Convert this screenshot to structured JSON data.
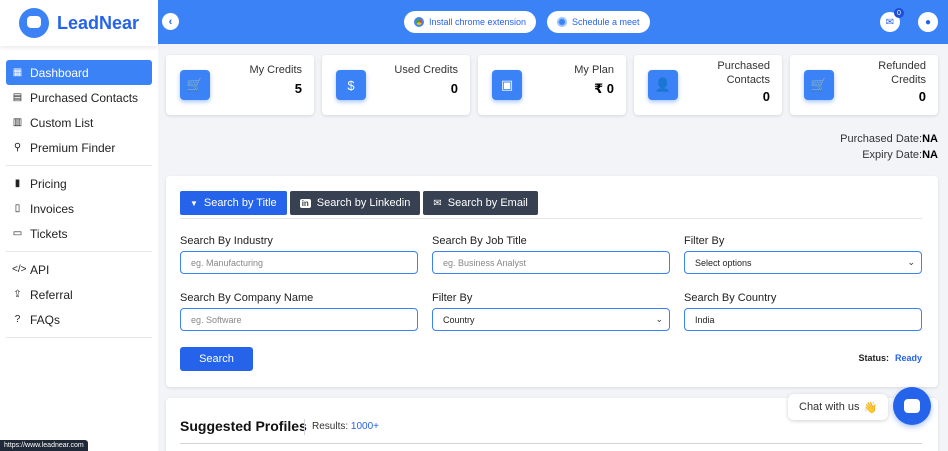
{
  "brand": {
    "name": "LeadNear"
  },
  "sidebar": {
    "items": [
      {
        "label": "Dashboard",
        "icon": "dashboard-icon",
        "glyph": "▦"
      },
      {
        "label": "Purchased Contacts",
        "icon": "contacts-icon",
        "glyph": "▤"
      },
      {
        "label": "Custom List",
        "icon": "list-icon",
        "glyph": "▥"
      },
      {
        "label": "Premium Finder",
        "icon": "search-icon",
        "glyph": "⚲"
      },
      {
        "label": "Pricing",
        "icon": "pricing-icon",
        "glyph": "▮"
      },
      {
        "label": "Invoices",
        "icon": "invoice-icon",
        "glyph": "▯"
      },
      {
        "label": "Tickets",
        "icon": "ticket-icon",
        "glyph": "▭"
      },
      {
        "label": "API",
        "icon": "code-icon",
        "glyph": "</>"
      },
      {
        "label": "Referral",
        "icon": "share-icon",
        "glyph": "⇪"
      },
      {
        "label": "FAQs",
        "icon": "question-icon",
        "glyph": "?"
      }
    ]
  },
  "status_url": "https://www.leadnear.com",
  "topbar": {
    "back_glyph": "‹",
    "chrome_label": "Install chrome extension",
    "meet_label": "Schedule a meet",
    "notifications_count": "0"
  },
  "cards": [
    {
      "label": "My Credits",
      "value": "5",
      "icon": "cart-icon",
      "glyph": "🛒"
    },
    {
      "label": "Used Credits",
      "value": "0",
      "icon": "dollar-icon",
      "glyph": "$"
    },
    {
      "label": "My Plan",
      "value": "₹ 0",
      "icon": "wallet-icon",
      "glyph": "▣"
    },
    {
      "label": "Purchased Contacts",
      "value": "0",
      "icon": "user-icon",
      "glyph": "👤"
    },
    {
      "label": "Refunded Credits",
      "value": "0",
      "icon": "cart-refund-icon",
      "glyph": "🛒"
    }
  ],
  "dates": {
    "purchased_label": "Purchased Date:",
    "purchased_value": "NA",
    "expiry_label": "Expiry Date:",
    "expiry_value": "NA"
  },
  "search": {
    "tabs": [
      {
        "label": "Search by Title",
        "glyph": "▼"
      },
      {
        "label": "Search by Linkedin",
        "glyph": "in"
      },
      {
        "label": "Search by Email",
        "glyph": "✉"
      }
    ],
    "industry_label": "Search By Industry",
    "industry_placeholder": "eg. Manufacturing",
    "job_title_label": "Search By Job Title",
    "job_title_placeholder": "eg. Business Analyst",
    "filter_label": "Filter By",
    "filter_value": "Select options",
    "company_label": "Search By Company Name",
    "company_placeholder": "eg. Software",
    "filter2_label": "Filter By",
    "filter2_value": "Country",
    "country_label": "Search By Country",
    "country_value": "India",
    "search_button": "Search",
    "status_label": "Status:",
    "status_value": "Ready"
  },
  "suggested": {
    "title": "Suggested Profiles",
    "results_label": "Results:",
    "results_value": "1000+"
  },
  "chat": {
    "label": "Chat with us",
    "emoji": "👋"
  }
}
